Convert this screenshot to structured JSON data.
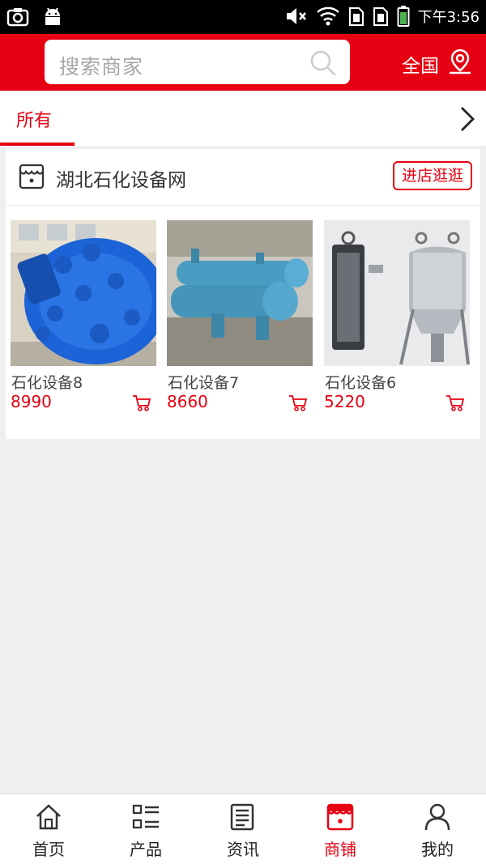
{
  "status_bar": {
    "time": "下午3:56",
    "icons": [
      "camera-icon",
      "android-icon",
      "mute-icon",
      "wifi-icon",
      "sim1-icon",
      "sim2-icon",
      "battery-icon"
    ]
  },
  "header": {
    "search_placeholder": "搜索商家",
    "region_label": "全国"
  },
  "tabs": {
    "active_label": "所有"
  },
  "shop": {
    "name": "湖北石化设备网",
    "enter_label": "进店逛逛",
    "products": [
      {
        "name": "石化设备8",
        "price": "8990"
      },
      {
        "name": "石化设备7",
        "price": "8660"
      },
      {
        "name": "石化设备6",
        "price": "5220"
      }
    ]
  },
  "bottom_nav": {
    "items": [
      {
        "label": "首页",
        "icon": "home-icon"
      },
      {
        "label": "产品",
        "icon": "list-icon"
      },
      {
        "label": "资讯",
        "icon": "news-icon"
      },
      {
        "label": "商铺",
        "icon": "store-icon"
      },
      {
        "label": "我的",
        "icon": "user-icon"
      }
    ],
    "active_index": 3
  },
  "colors": {
    "brand": "#e60012",
    "status_bar": "#000000",
    "background": "#efefef"
  }
}
